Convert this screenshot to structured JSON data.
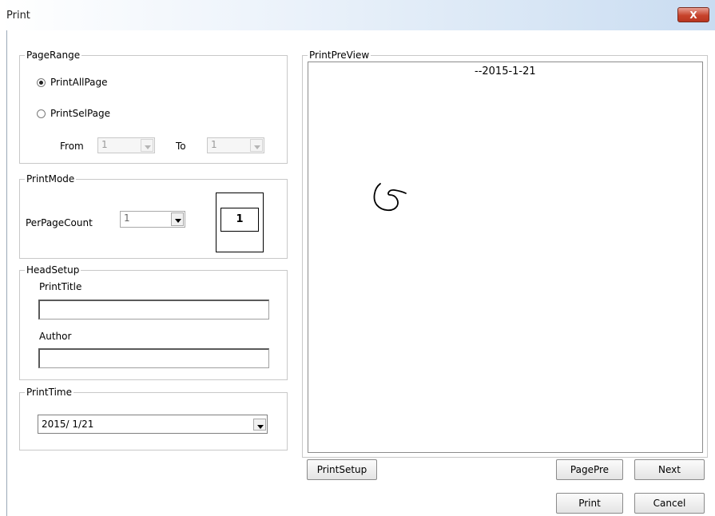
{
  "window": {
    "title": "Print",
    "close_label": "X"
  },
  "page_range": {
    "legend": "PageRange",
    "print_all_label": "PrintAllPage",
    "print_sel_label": "PrintSelPage",
    "from_label": "From",
    "from_value": "1",
    "to_label": "To",
    "to_value": "1",
    "selected": "PrintAllPage"
  },
  "print_mode": {
    "legend": "PrintMode",
    "per_page_label": "PerPageCount",
    "per_page_value": "1",
    "layout_preview_value": "1"
  },
  "head_setup": {
    "legend": "HeadSetup",
    "title_label": "PrintTitle",
    "title_value": "",
    "author_label": "Author",
    "author_value": ""
  },
  "print_time": {
    "legend": "PrintTime",
    "value": "2015/ 1/21"
  },
  "preview": {
    "legend": "PrintPreView",
    "date_text": "--2015-1-21"
  },
  "buttons": {
    "print_setup": "PrintSetup",
    "page_pre": "PagePre",
    "next": "Next",
    "print": "Print",
    "cancel": "Cancel"
  }
}
